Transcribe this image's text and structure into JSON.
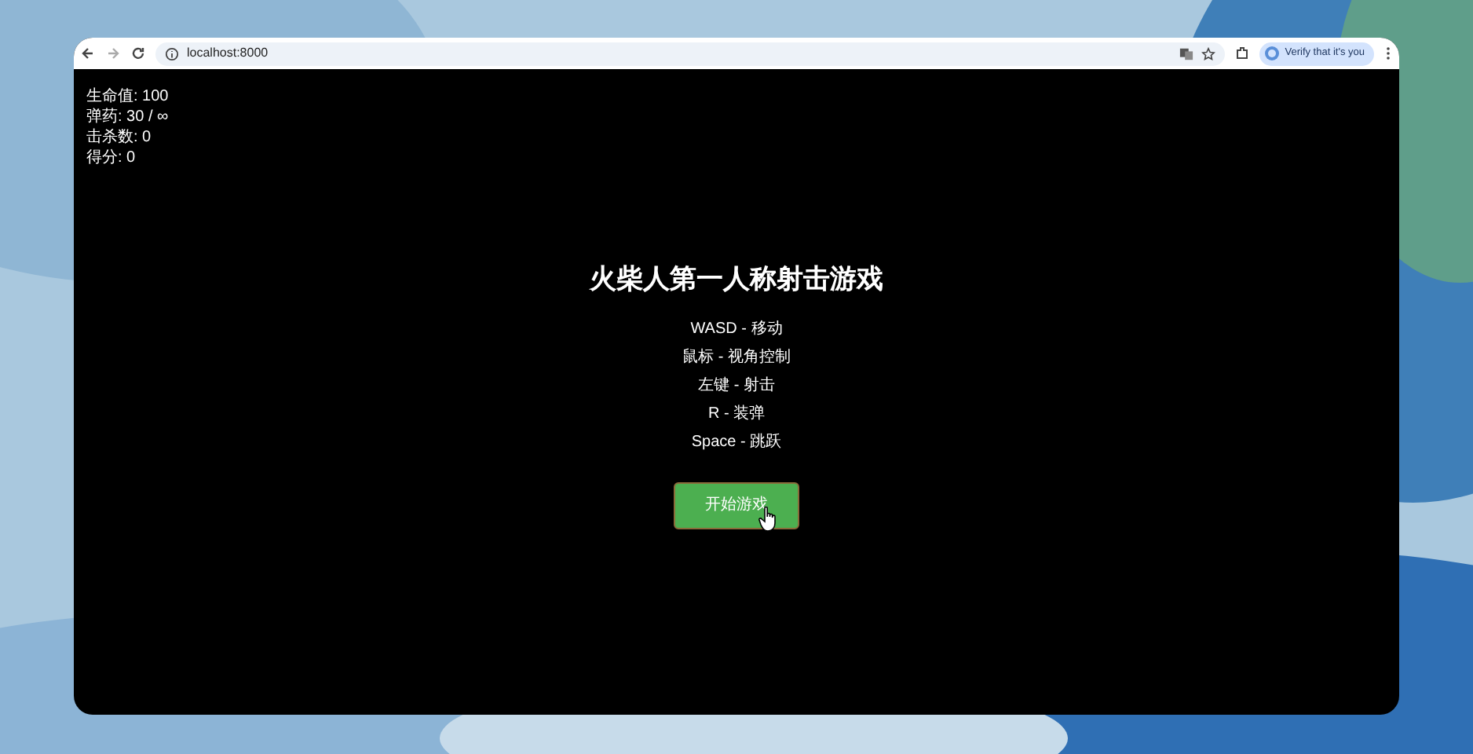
{
  "browser": {
    "address": "localhost:8000",
    "profile_button": "Verify that it's you"
  },
  "hud": [
    "生命值: 100",
    "弹药: 30 / ∞",
    "击杀数: 0",
    "得分: 0"
  ],
  "menu": {
    "title": "火柴人第一人称射击游戏",
    "controls": [
      "WASD - 移动",
      "鼠标 - 视角控制",
      "左键 - 射击",
      "R - 装弹",
      "Space - 跳跃"
    ],
    "start_button": "开始游戏"
  }
}
